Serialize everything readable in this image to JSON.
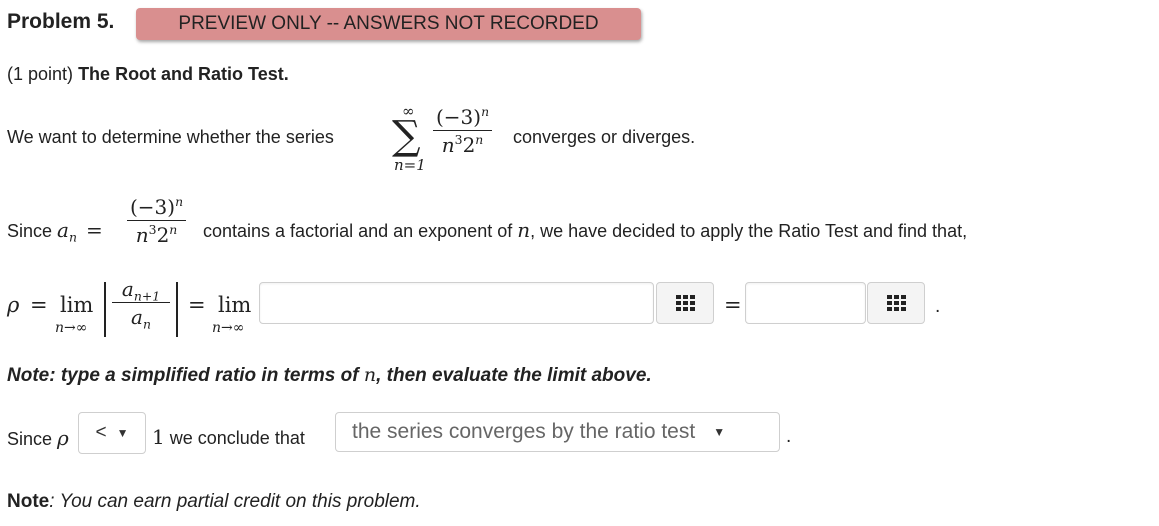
{
  "header": {
    "problem_label": "Problem 5.",
    "preview_banner": "PREVIEW ONLY -- ANSWERS NOT RECORDED"
  },
  "intro": {
    "points": "(1 point)",
    "title": "The Root and Ratio Test."
  },
  "statement": {
    "prefix": "We want to determine whether the series",
    "suffix": "converges or diverges.",
    "sum_upper": "∞",
    "sum_lower": "n=1"
  },
  "term": {
    "numerator": "(−3)",
    "numerator_exp": "n",
    "denominator": "n",
    "denominator_exp1": "3",
    "denominator_mid": "2",
    "denominator_exp2": "n"
  },
  "since_line": {
    "prefix": "Since",
    "a_n": "a",
    "a_n_sub": "n",
    "equals": "=",
    "suffix_a": "contains a factorial and an exponent of",
    "n_var": "n",
    "suffix_b": ", we have decided to apply the Ratio Test and find that,"
  },
  "limit_line": {
    "rho": "ρ",
    "equals": "=",
    "lim": "lim",
    "lim_sub": "n→∞",
    "num_a": "a",
    "num_sub": "n+1",
    "den_a": "a",
    "den_sub": "n",
    "ratio_input_value": "",
    "limit_input_value": "",
    "period": "."
  },
  "note_simplify": {
    "prefix": "Note: type a simplified ratio in terms of",
    "n_var": "n",
    "suffix": ", then evaluate the limit above."
  },
  "conclusion": {
    "prefix": "Since",
    "rho": "ρ",
    "comparison_selected": "<",
    "one": "1",
    "middle": "we conclude that",
    "conclusion_selected": "the series converges by the ratio test",
    "period": "."
  },
  "footer_note": {
    "label": "Note",
    "text": ": You can earn partial credit on this problem."
  },
  "icons": {
    "palette": "equation-palette-icon",
    "dropdown": "dropdown-caret-icon"
  }
}
